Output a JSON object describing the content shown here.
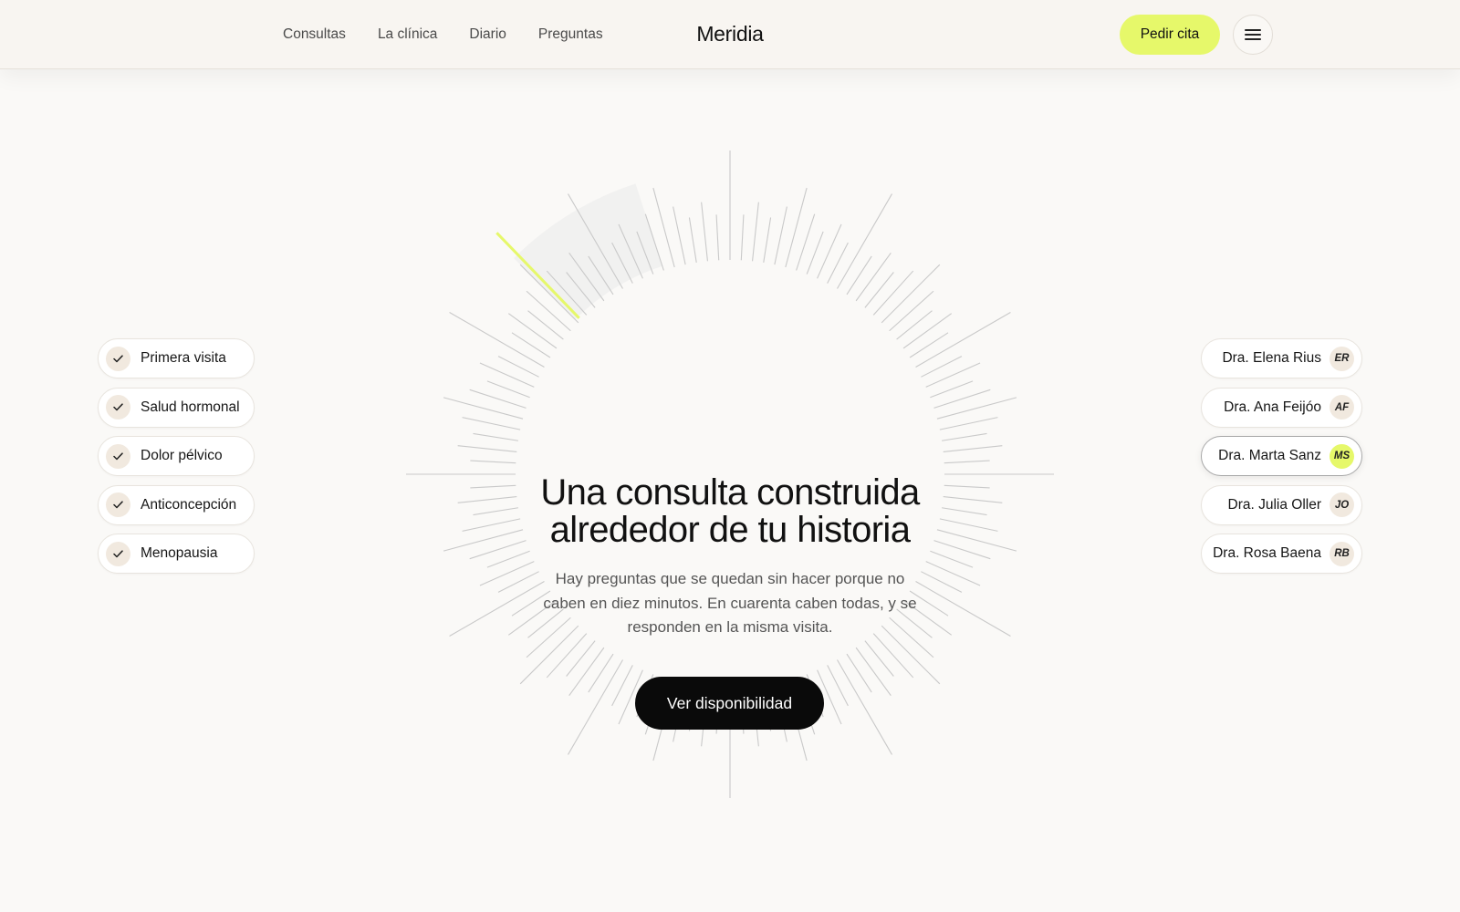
{
  "header": {
    "nav": [
      "Consultas",
      "La clínica",
      "Diario",
      "Preguntas"
    ],
    "logo": "Meridia",
    "cta_label": "Pedir cita",
    "accent_color": "#e6f86a",
    "menu_icon": "hamburger-menu-icon"
  },
  "hero": {
    "title_line1": "Una consulta construida",
    "title_line2": "alrededor de tu historia",
    "subtitle": "Hay preguntas que se quedan sin hacer porque no caben en diez minutos. En cuarenta caben todas, y se responden en la misma visita.",
    "button_label": "Ver disponibilidad"
  },
  "topics": [
    {
      "label": "Primera visita",
      "icon": "check-icon"
    },
    {
      "label": "Salud hormonal",
      "icon": "check-icon"
    },
    {
      "label": "Dolor pélvico",
      "icon": "check-icon"
    },
    {
      "label": "Anticoncepción",
      "icon": "check-icon"
    },
    {
      "label": "Menopausia",
      "icon": "check-icon"
    }
  ],
  "doctors": [
    {
      "name": "Dra. Elena Rius",
      "initials": "ER",
      "selected": false
    },
    {
      "name": "Dra. Ana Feijóo",
      "initials": "AF",
      "selected": false
    },
    {
      "name": "Dra. Marta Sanz",
      "initials": "MS",
      "selected": true
    },
    {
      "name": "Dra. Julia Oller",
      "initials": "JO",
      "selected": false
    },
    {
      "name": "Dra. Rosa Baena",
      "initials": "RB",
      "selected": false
    }
  ]
}
